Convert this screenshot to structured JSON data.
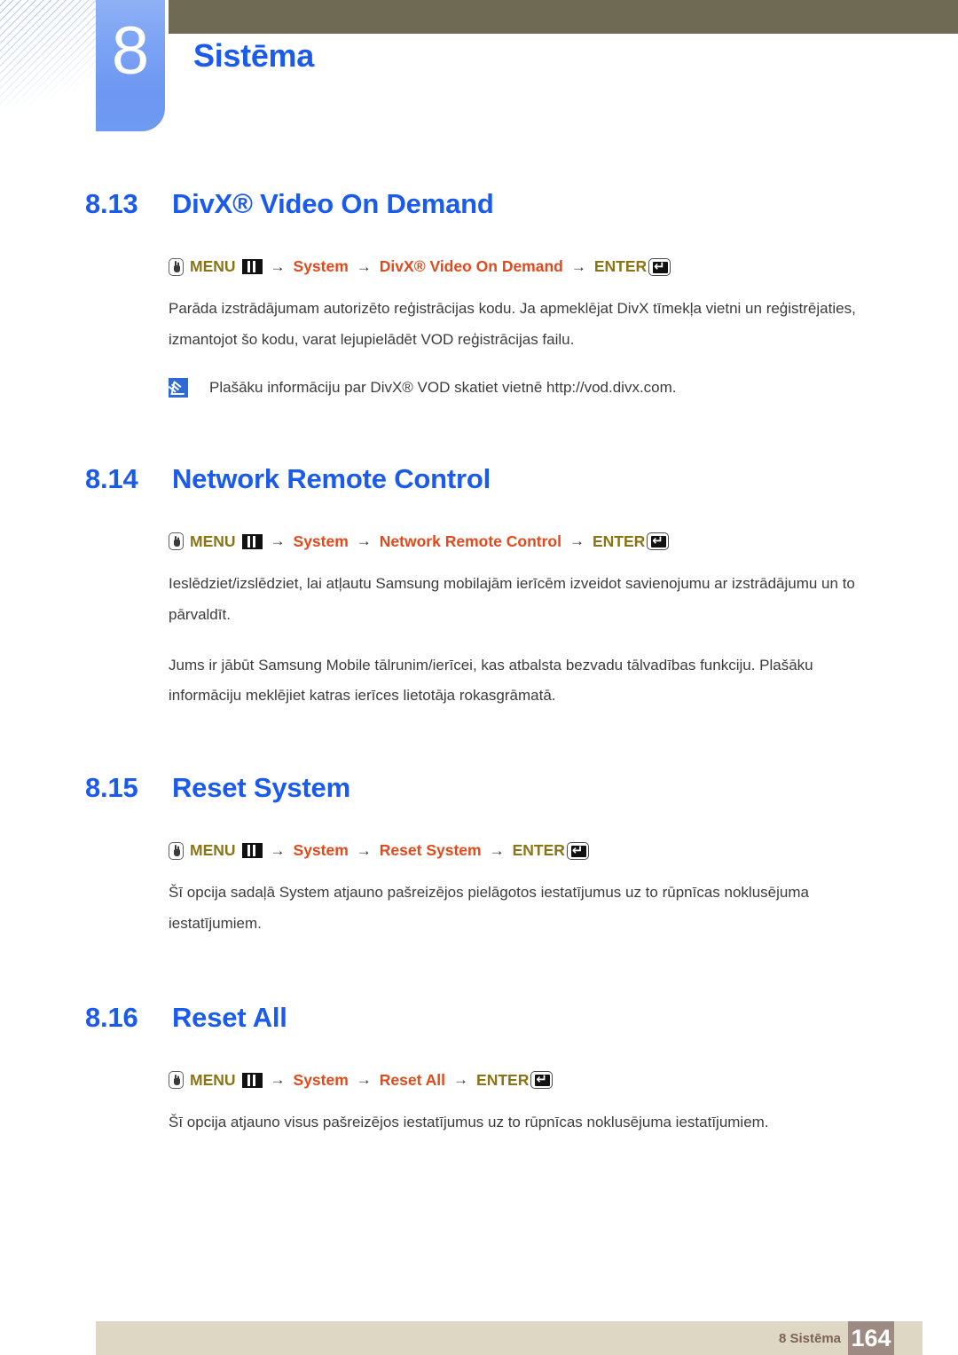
{
  "header": {
    "chapter_number": "8",
    "chapter_title": "Sistēma",
    "accent_blue": "#1a5bec",
    "badge_blue": "#7ba3f4",
    "olive": "#6e6a54"
  },
  "icons": {
    "hand": "hand-pointer-icon",
    "menu_bars": "menu-bars-icon",
    "enter_key": "enter-key-icon",
    "note": "note-icon"
  },
  "sections": [
    {
      "number": "8.13",
      "title": "DivX® Video On Demand",
      "menu_path": {
        "menu_label": "MENU",
        "items": [
          "System",
          "DivX® Video On Demand"
        ],
        "enter_label": "ENTER",
        "arrow": "→"
      },
      "paragraphs": [
        "Parāda izstrādājumam autorizēto reģistrācijas kodu. Ja apmeklējat DivX tīmekļa vietni un reģistrējaties, izmantojot šo kodu, varat lejupielādēt VOD reģistrācijas failu."
      ],
      "note": "Plašāku informāciju par DivX® VOD skatiet vietnē http://vod.divx.com."
    },
    {
      "number": "8.14",
      "title": "Network Remote Control",
      "menu_path": {
        "menu_label": "MENU",
        "items": [
          "System",
          "Network Remote Control"
        ],
        "enter_label": "ENTER",
        "arrow": "→"
      },
      "paragraphs": [
        "Ieslēdziet/izslēdziet, lai atļautu Samsung mobilajām ierīcēm izveidot savienojumu ar izstrādājumu un to pārvaldīt.",
        "Jums ir jābūt Samsung Mobile tālrunim/ierīcei, kas atbalsta bezvadu tālvadības funkciju. Plašāku informāciju meklējiet katras ierīces lietotāja rokasgrāmatā."
      ]
    },
    {
      "number": "8.15",
      "title": "Reset System",
      "menu_path": {
        "menu_label": "MENU",
        "items": [
          "System",
          "Reset System"
        ],
        "enter_label": "ENTER",
        "arrow": "→"
      },
      "paragraphs": [
        "Šī opcija sadaļā System atjauno pašreizējos pielāgotos iestatījumus uz to rūpnīcas noklusējuma iestatījumiem."
      ]
    },
    {
      "number": "8.16",
      "title": "Reset All",
      "menu_path": {
        "menu_label": "MENU",
        "items": [
          "System",
          "Reset All"
        ],
        "enter_label": "ENTER",
        "arrow": "→"
      },
      "paragraphs": [
        "Šī opcija atjauno visus pašreizējos iestatījumus uz to rūpnīcas noklusējuma iestatījumiem."
      ]
    }
  ],
  "footer": {
    "label": "8 Sistēma",
    "page_number": "164"
  }
}
